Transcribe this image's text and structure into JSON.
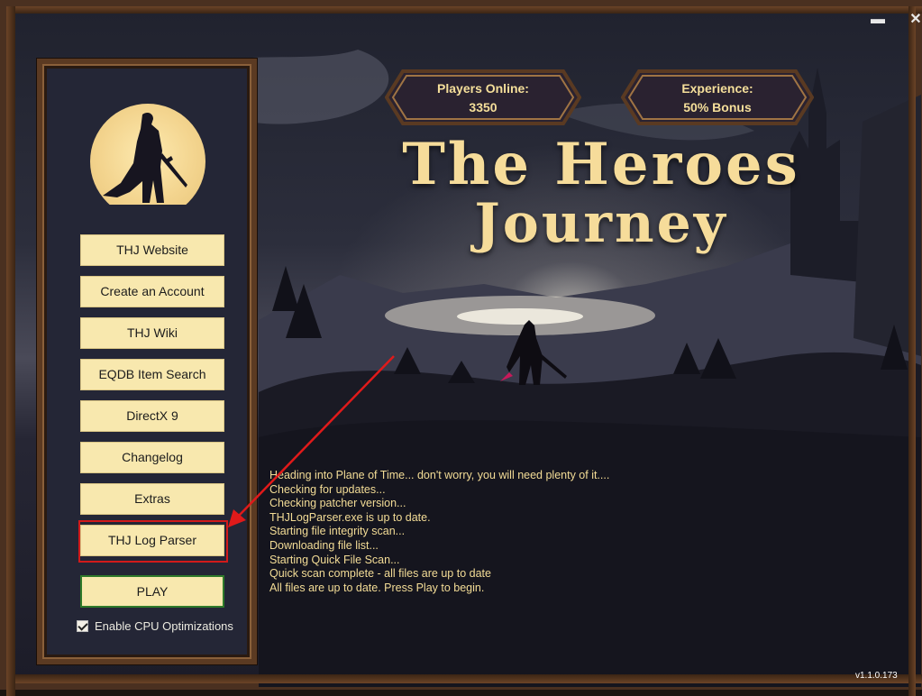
{
  "window": {
    "minimize_icon": "minimize-icon",
    "close_icon": "close-icon",
    "minimize_glyph": "▬",
    "close_glyph": "✕"
  },
  "sidebar": {
    "buttons": [
      {
        "label": "THJ Website"
      },
      {
        "label": "Create an Account"
      },
      {
        "label": "THJ Wiki"
      },
      {
        "label": "EQDB Item Search"
      },
      {
        "label": "DirectX 9"
      },
      {
        "label": "Changelog"
      },
      {
        "label": "Extras"
      },
      {
        "label": "THJ Log Parser"
      }
    ],
    "play_label": "PLAY",
    "cpu_label": "Enable CPU Optimizations",
    "cpu_checked": true
  },
  "header": {
    "players_label": "Players Online:",
    "players_value": "3350",
    "experience_label": "Experience:",
    "experience_value": "50% Bonus",
    "title_line1": "The Heroes",
    "title_line2": "Journey"
  },
  "log": {
    "lines": [
      "Heading into Plane of Time... don't worry, you will need plenty of it....",
      "Checking for updates...",
      "Checking patcher version...",
      "THJLogParser.exe is up to date.",
      "Starting file integrity scan...",
      "Downloading file list...",
      "Starting Quick File Scan...",
      "Quick scan complete - all files are up to date",
      "All files are up to date. Press Play to begin."
    ]
  },
  "footer": {
    "version": "v1.1.0.173"
  },
  "colors": {
    "button_bg": "#f8e8ae",
    "gold_text": "#f5df9a",
    "highlight_red": "#d21a1a",
    "play_border": "#2f7a2a"
  }
}
